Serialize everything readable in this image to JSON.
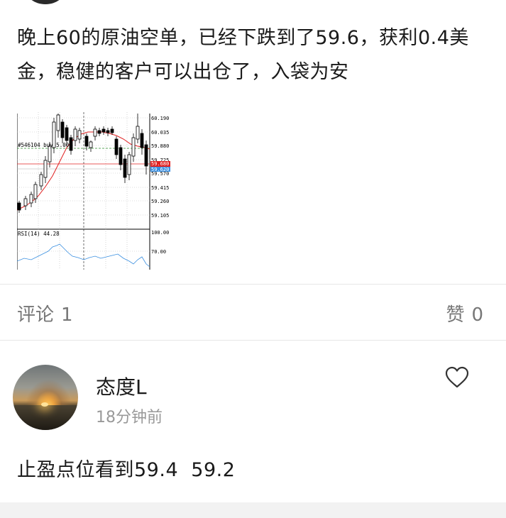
{
  "post": {
    "text": "晚上60的原油空单，已经下跌到了59.6，获利0.4美金，稳健的客户可以出仓了，入袋为安"
  },
  "chart_image": {
    "order_label": "#546104 buy 5.00",
    "rsi_label": "RSI(14) 44.28",
    "price_ticks": [
      "60.190",
      "60.035",
      "59.880",
      "59.725",
      "59.570",
      "59.415",
      "59.260",
      "59.105"
    ],
    "price_tag_red": "59.680",
    "price_tag_blue": "59.620",
    "rsi_ticks": [
      "100.00",
      "70.00"
    ],
    "colors": {
      "ma_line": "#e02020",
      "rsi_line": "#3a8fe0",
      "tag_red": "#e02020",
      "tag_blue": "#3a8fe0"
    }
  },
  "stats": {
    "comments_label": "评论",
    "comments_count": "1",
    "likes_label": "赞",
    "likes_count": "0"
  },
  "comment": {
    "username": "态度L",
    "time": "18分钟前",
    "text": "止盈点位看到59.4  59.2",
    "like_icon": "heart-outline-icon"
  }
}
